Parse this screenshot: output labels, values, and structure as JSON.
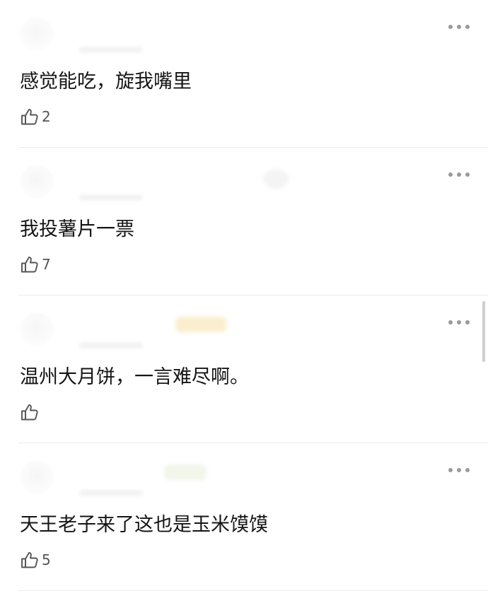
{
  "comments": [
    {
      "text": "感觉能吃，旋我嘴里",
      "likes": "2"
    },
    {
      "text": "我投薯片一票",
      "likes": "7"
    },
    {
      "text": "温州大月饼，一言难尽啊。",
      "likes": ""
    },
    {
      "text": "天王老子来了这也是玉米馍馍",
      "likes": "5"
    }
  ],
  "icons": {
    "like": "thumbs-up-icon",
    "more": "more-options-icon"
  },
  "colors": {
    "text": "#151515",
    "secondary": "#555555",
    "icon": "#9a9a9a",
    "divider": "#ececec"
  }
}
